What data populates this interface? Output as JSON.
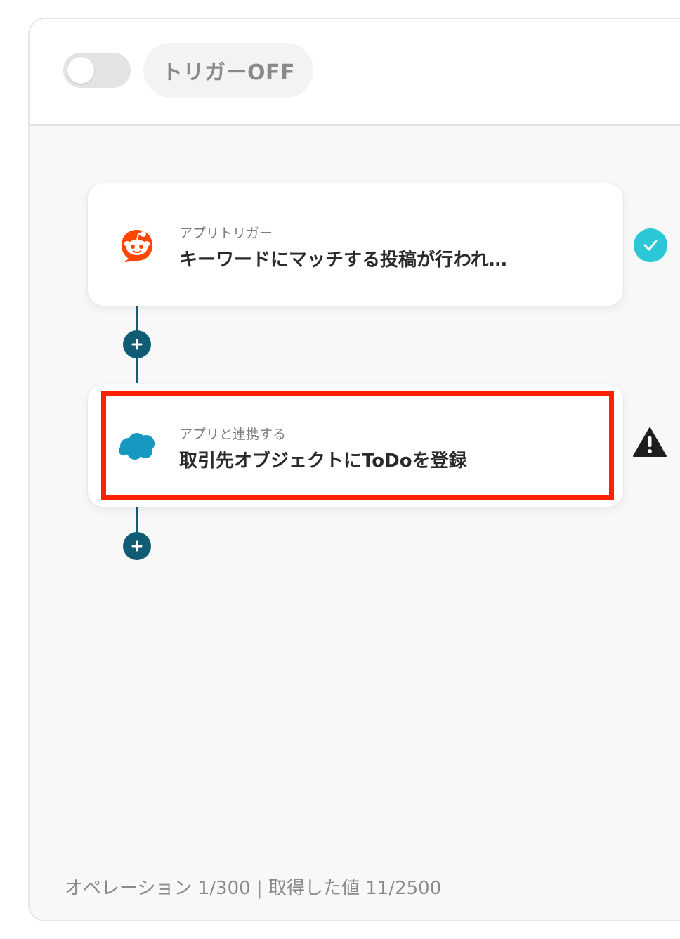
{
  "header": {
    "trigger_toggle_state": "off",
    "trigger_label": "トリガーOFF"
  },
  "flow": {
    "steps": [
      {
        "sublabel": "アプリトリガー",
        "title": "キーワードにマッチする投稿が行われ…",
        "app_icon": "reddit-icon",
        "status": "complete",
        "status_icon": "check-icon"
      },
      {
        "sublabel": "アプリと連携する",
        "title": "取引先オブジェクトにToDoを登録",
        "app_icon": "salesforce-icon",
        "status": "warning",
        "status_icon": "warning-icon",
        "highlighted": true
      }
    ],
    "add_step_icon": "plus-icon"
  },
  "footer": {
    "usage_text": "オペレーション 1/300 | 取得した値 11/2500"
  },
  "colors": {
    "flow_line": "#105f78",
    "check_badge": "#2bc7d6",
    "highlight_border": "#ff2200",
    "reddit_orange": "#ff4500",
    "salesforce_blue": "#1798c1"
  }
}
